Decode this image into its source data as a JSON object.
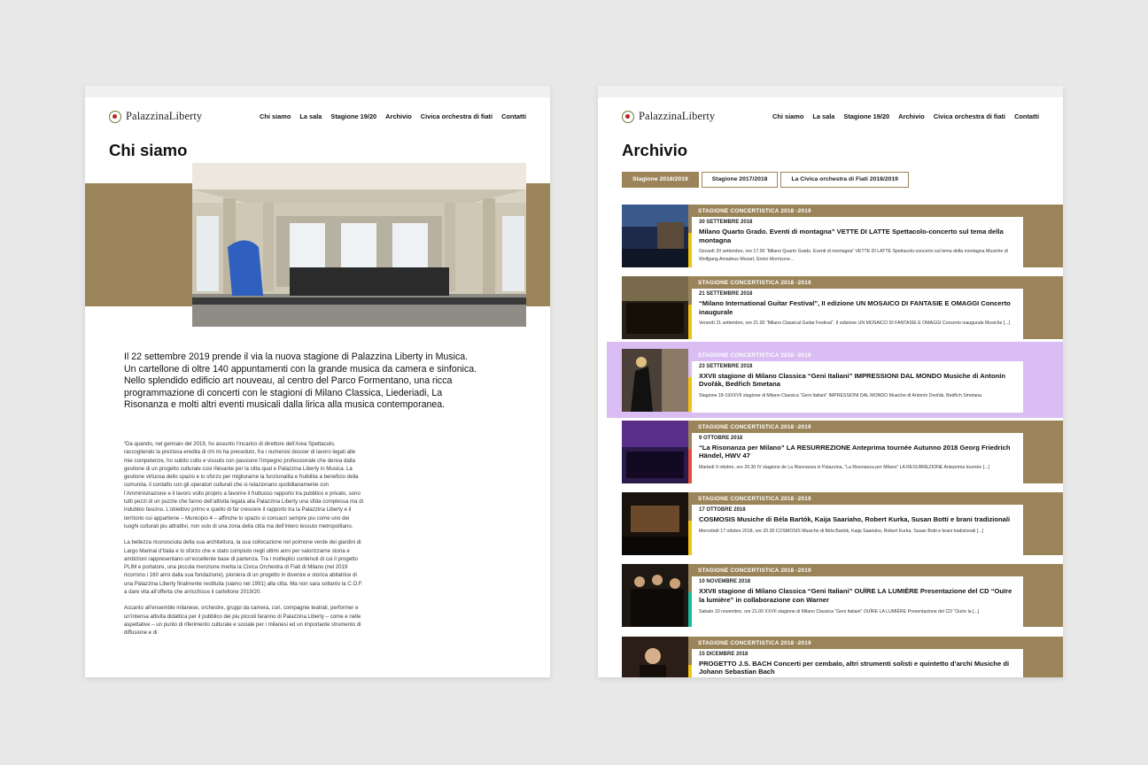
{
  "nav": [
    "Chi siamo",
    "La sala",
    "Stagione 19/20",
    "Archivio",
    "Civica orchestra di fiati",
    "Contatti"
  ],
  "logo_text": "PalazzinaLiberty",
  "left": {
    "title": "Chi siamo",
    "intro": "Il 22 settembre 2019 prende il via la nuova stagione di Palazzina Liberty in Musica. Un cartellone di oltre 140 appuntamenti con la grande musica da camera e sinfonica. Nello splendido edificio art nouveau, al centro del Parco Formentano, una ricca programmazione di concerti con le stagioni di Milano Classica, Liederiadi, La Risonanza e molti altri eventi musicali dalla lirica alla musica contemporanea.",
    "paragraphs": [
      "“Da quando, nel gennaio del 2019, ho assunto l’incarico di direttore dell’Area Spettacolo, raccogliendo la preziosa eredita di chi mi ha preceduto, fra i numerosi dossier di lavoro legati alle mie competenze, ho subito colto e vissuto con passione l’impegno professionale che deriva dalla gestione di un progetto culturale cosi rilevante per la citta qual e Palazzina Liberty in Musica. La gestione virtuosa dello spazio e lo sforzo per migliorarne la funzionalita e fruibilita a beneficio della comunita, il contatto con gli operatori culturali che si relazionano quotidianamente con l’Amministrazione e il lavoro volto proprio a favorire il fruttuoso rapporto tra pubblico e privato, sono tutti pezzi di un puzzle che fanno dell’attivita legata alla Palazzina Liberty una sfida complessa ma di indubbio fascino. L’obiettivo primo e quello di far crescere il rapporto tra la Palazzina Liberty e il territorio cui appartiene – Municipio 4 – affinche lo spazio si consacri sempre piu come uno dei luoghi culturali piu attrattivi, non solo di una zona della citta ma dell’intero tessuto metropolitano.",
      "La bellezza riconosciuta della sua architettura, la sua collocazione nel polmone verde dei giardini di Largo Marinai d’Italia e lo sforzo che e stato compiuto negli ultimi anni per valorizzarne storia e ambizioni rappresentano un’eccellente base di partenza. Tra i molteplici contenuti di cui il progetto PLIM e portatore, una piccola menzione merita la Civica Orchestra di Fiati di Milano (nel 2019 ricorrono i 160 anni dalla sua fondazione), pioniera di un progetto in divenire e storica abitatrice di una Palazzina Liberty finalmente restituita (siamo nel 1991) alla citta. Ma non sara soltanto la C.O.F. a dare vita all’offerta che arricchisce il cartellone 2019/20.",
      "Accanto all’ensemble milanese, orchestre, gruppi da camera, cori, compagnie teatrali, performer e un’intensa attivita didattica per il pubblico dei piu piccoli faranno di Palazzina Liberty – come e nelle aspettative – un punto di riferimento culturale e sociale per i milanesi ed un importante strumento di diffusione e di"
    ]
  },
  "right": {
    "title": "Archivio",
    "tabs": [
      "Stagione 2018/2019",
      "Stagione 2017/2018",
      "La Civica orchestra di Fiati 2018/2019"
    ],
    "active_tab": 0,
    "entries": [
      {
        "category": "STAGIONE CONCERTISTICA 2018 -2019",
        "date": "30 SETTEMBRE 2018",
        "title": "Milano Quarto Grado. Eventi di montagna” VETTE DI LATTE Spettacolo-concerto sul tema della montagna",
        "excerpt": "Giovedì 20 settembre, ore 17.00 “Milano Quarto Grado. Eventi di montagna” VETTE DI LATTE Spettacolo-concerto sul tema della montagna Musiche di Wolfgang Amadeus Mozart, Ennio Morricone...",
        "accent": "#f1c40f"
      },
      {
        "category": "STAGIONE CONCERTISTICA 2018 -2019",
        "date": "21 SETTEMBRE 2018",
        "title": "“Milano International Guitar Festival”, II edizione UN MOSAICO DI FANTASIE E OMAGGI Concerto inaugurale",
        "excerpt": "Venerdì 21 settembre, ore 21.00 “Milano Classical Guitar Festival”, II edizione UN MOSAICO DI FANTASIE E OMAGGI Concerto inaugurale Musiche [...]",
        "accent": "#f1c40f"
      },
      {
        "category": "STAGIONE CONCERTISTICA 2018 -2019",
        "date": "23 SETTEMBRE 2018",
        "title": "XXVII stagione di Milano Classica “Geni Italiani” IMPRESSIONI DAL MONDO Musiche di Antonín Dvořák, Bedřich Smetana",
        "excerpt": "Stagione 18-19XXVII stagione di Milano Classica “Geni Italiani” IMPRESSIONI DAL MONDO Musiche di Antonín Dvořák, Bedřich Smetana",
        "accent": "#f1c40f"
      },
      {
        "category": "STAGIONE CONCERTISTICA 2018 -2019",
        "date": "9 OTTOBRE 2018",
        "title": "“La Risonanza per Milano” LA RESURREZIONE Anteprima tournée Autunno 2018 Georg Friedrich Händel, HWV 47",
        "excerpt": "Martedì 9 ottobre, ore 20.30 IV stagione de La Risonanza in Palazzina, “La Risonanza per Milano” LA RESURREZIONE Anteprima tournée [...]",
        "accent": "#e74c3c"
      },
      {
        "category": "STAGIONE CONCERTISTICA 2018 -2019",
        "date": "17 OTTOBRE 2018",
        "title": "COSMOSIS Musiche di Béla Bartók, Kaija Saariaho, Robert Kurka, Susan Botti e brani tradizionali",
        "excerpt": "Mercoledì 17 ottobre 2018, ore 20.30 COSMOSIS Musiche di Béla Bartók, Kaija Saariaho, Robert Kurka, Susan Botti e brani tradizionali [...]",
        "accent": "#f1c40f"
      },
      {
        "category": "STAGIONE CONCERTISTICA 2018 -2019",
        "date": "10 NOVEMBRE 2018",
        "title": "XXVII stagione di Milano Classica “Geni Italiani” OUÏRE LA LUMIÈRE Presentazione del CD “Ouïre la lumière” in collaborazione con Warner",
        "excerpt": "Sabato 10 novembre, ore 21.00 XXVII stagione di Milano Classica “Geni Italiani” OUÏRE LA LUMIÈRE Presentazione del CD “Ouïre la [...]",
        "accent": "#1abc9c"
      },
      {
        "category": "STAGIONE CONCERTISTICA 2018 -2019",
        "date": "15 DICEMBRE 2018",
        "title": "PROGETTO J.S. BACH Concerti per cembalo, altri strumenti solisti e quintetto d’archi Musiche di Johann Sebastian Bach",
        "excerpt": "",
        "accent": "#f1c40f"
      }
    ]
  }
}
